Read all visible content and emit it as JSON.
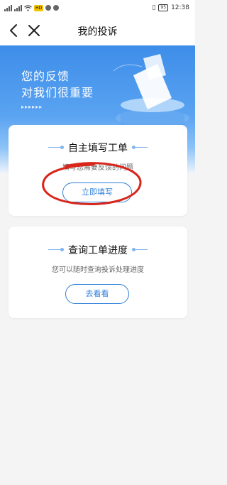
{
  "status_bar": {
    "carrier_badge": "HD",
    "battery": "95",
    "time": "12:38"
  },
  "nav": {
    "title": "我的投诉",
    "back_icon": "chevron-left-icon",
    "close_icon": "close-icon"
  },
  "banner": {
    "line1": "您的反馈",
    "line2": "对我们很重要",
    "arrows": "▸▸▸▸▸▸"
  },
  "card_self_service": {
    "title": "自主填写工单",
    "subtitle": "填写您需要反馈的问题",
    "button_label": "立即填写"
  },
  "card_progress": {
    "title": "查询工单进度",
    "subtitle": "您可以随时查询投诉处理进度",
    "button_label": "去看看"
  },
  "colors": {
    "accent": "#2f7fd8",
    "banner_top": "#3d8de9",
    "annotation": "#d9261c"
  }
}
